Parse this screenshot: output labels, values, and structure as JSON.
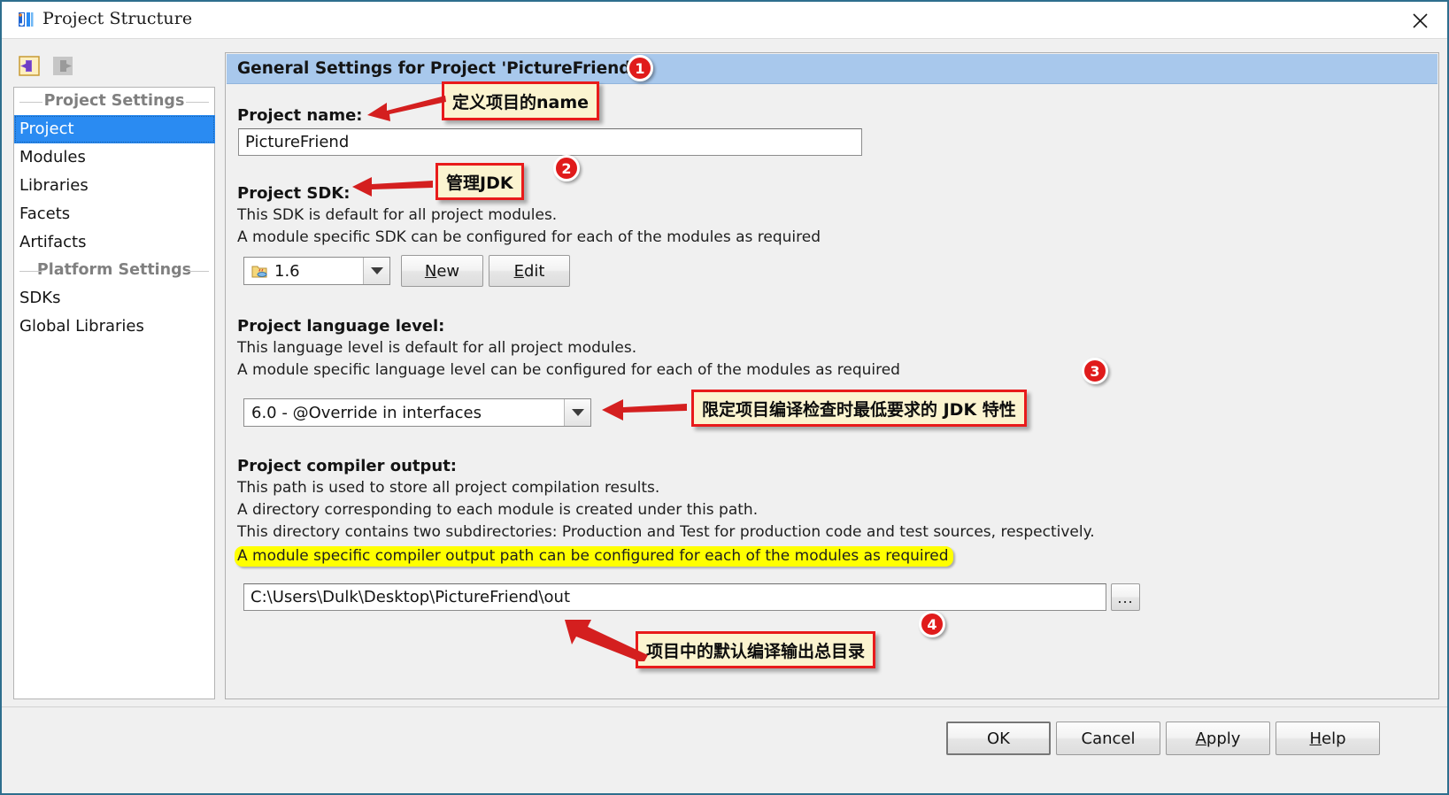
{
  "window": {
    "title": "Project Structure",
    "app_icon": "intellij-idea-icon",
    "close_label": "×"
  },
  "toolbar": {
    "back_icon": "back-arrow-icon",
    "forward_icon": "forward-arrow-icon"
  },
  "sidebar": {
    "groups": [
      {
        "title": "Project Settings",
        "items": [
          {
            "label": "Project",
            "selected": true
          },
          {
            "label": "Modules",
            "selected": false
          },
          {
            "label": "Libraries",
            "selected": false
          },
          {
            "label": "Facets",
            "selected": false
          },
          {
            "label": "Artifacts",
            "selected": false
          }
        ]
      },
      {
        "title": "Platform Settings",
        "items": [
          {
            "label": "SDKs",
            "selected": false
          },
          {
            "label": "Global Libraries",
            "selected": false
          }
        ]
      }
    ]
  },
  "main": {
    "header": "General Settings for Project 'PictureFriend'",
    "project_name": {
      "label": "Project name:",
      "value": "PictureFriend"
    },
    "project_sdk": {
      "label": "Project SDK:",
      "desc1": "This SDK is default for all project modules.",
      "desc2": "A module specific SDK can be configured for each of the modules as required",
      "selected": "1.6",
      "sdk_icon": "java-sdk-icon",
      "new_button": "New",
      "new_mnemonic": "N",
      "edit_button": "Edit",
      "edit_mnemonic": "E"
    },
    "language_level": {
      "label": "Project language level:",
      "desc1": "This language level is default for all project modules.",
      "desc2": "A module specific language level can be configured for each of the modules as required",
      "selected": "6.0 - @Override in interfaces"
    },
    "compiler_output": {
      "label": "Project compiler output:",
      "desc1": "This path is used to store all project compilation results.",
      "desc2": "A directory corresponding to each module is created under this path.",
      "desc3": "This directory contains two subdirectories: Production and Test for production code and test sources, respectively.",
      "desc4_highlighted": "A module specific compiler output path can be configured for each of the modules as required",
      "path_value": "C:\\Users\\Dulk\\Desktop\\PictureFriend\\out",
      "browse_button": "..."
    }
  },
  "annotations": [
    {
      "number": "1",
      "text": "定义项目的name"
    },
    {
      "number": "2",
      "text": "管理JDK"
    },
    {
      "number": "3",
      "text": "限定项目编译检查时最低要求的 JDK 特性"
    },
    {
      "number": "4",
      "text": "项目中的默认编译输出总目录"
    }
  ],
  "footer": {
    "buttons": [
      {
        "label": "OK",
        "mnemonic": "",
        "default": true
      },
      {
        "label": "Cancel",
        "mnemonic": "",
        "default": false
      },
      {
        "label": "Apply",
        "mnemonic": "A",
        "default": false
      },
      {
        "label": "Help",
        "mnemonic": "H",
        "default": false
      }
    ]
  },
  "colors": {
    "accent": "#2a8bf2",
    "header_bg": "#a8c8ec",
    "annotation_border": "#e81b1b",
    "annotation_bg": "#fbf4d0",
    "highlight": "#ffff00"
  }
}
